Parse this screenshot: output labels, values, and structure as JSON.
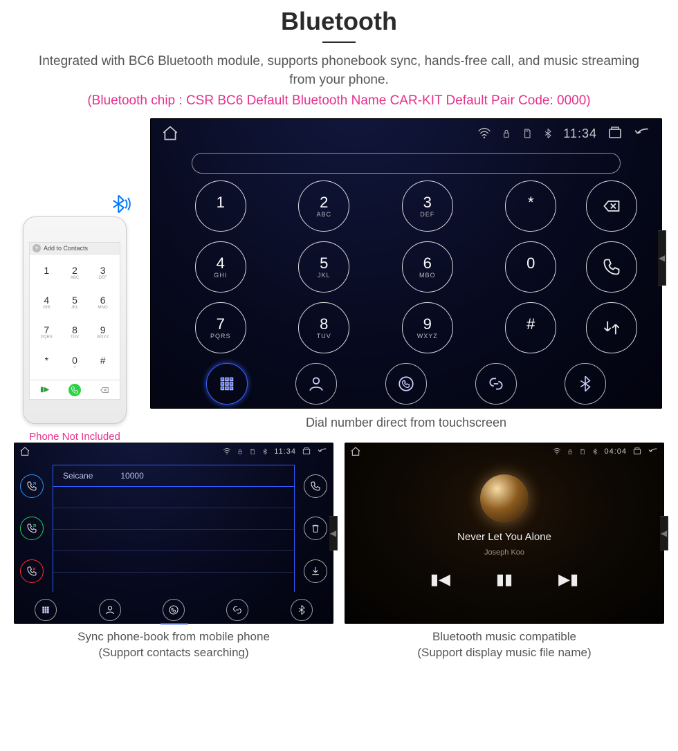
{
  "header": {
    "title": "Bluetooth",
    "subtitle": "Integrated with BC6 Bluetooth module, supports phonebook sync, hands-free call, and music streaming from your phone.",
    "specs": "(Bluetooth chip : CSR BC6    Default Bluetooth Name CAR-KIT    Default Pair Code: 0000)"
  },
  "phone": {
    "add_label": "Add to Contacts",
    "caption": "Phone Not Included",
    "keys": [
      {
        "d": "1",
        "s": ""
      },
      {
        "d": "2",
        "s": "ABC"
      },
      {
        "d": "3",
        "s": "DEF"
      },
      {
        "d": "4",
        "s": "GHI"
      },
      {
        "d": "5",
        "s": "JKL"
      },
      {
        "d": "6",
        "s": "MNO"
      },
      {
        "d": "7",
        "s": "PQRS"
      },
      {
        "d": "8",
        "s": "TUV"
      },
      {
        "d": "9",
        "s": "WXYZ"
      },
      {
        "d": "*",
        "s": ""
      },
      {
        "d": "0",
        "s": "+"
      },
      {
        "d": "#",
        "s": ""
      }
    ]
  },
  "dialer": {
    "status_time": "11:34",
    "caption": "Dial number direct from touchscreen",
    "keys": [
      {
        "d": "1",
        "s": ""
      },
      {
        "d": "2",
        "s": "ABC"
      },
      {
        "d": "3",
        "s": "DEF"
      },
      {
        "d": "*",
        "s": ""
      },
      {
        "d": "4",
        "s": "GHI"
      },
      {
        "d": "5",
        "s": "JKL"
      },
      {
        "d": "6",
        "s": "MBO"
      },
      {
        "d": "0",
        "s": ""
      },
      {
        "d": "7",
        "s": "PQRS"
      },
      {
        "d": "8",
        "s": "TUV"
      },
      {
        "d": "9",
        "s": "WXYZ"
      },
      {
        "d": "#",
        "s": ""
      }
    ]
  },
  "phonebook": {
    "status_time": "11:34",
    "contact_name": "Seicane",
    "contact_number": "10000",
    "caption_l1": "Sync phone-book from mobile phone",
    "caption_l2": "(Support contacts searching)"
  },
  "music": {
    "status_time": "04:04",
    "track": "Never Let You Alone",
    "artist": "Joseph Koo",
    "caption_l1": "Bluetooth music compatible",
    "caption_l2": "(Support display music file name)"
  }
}
